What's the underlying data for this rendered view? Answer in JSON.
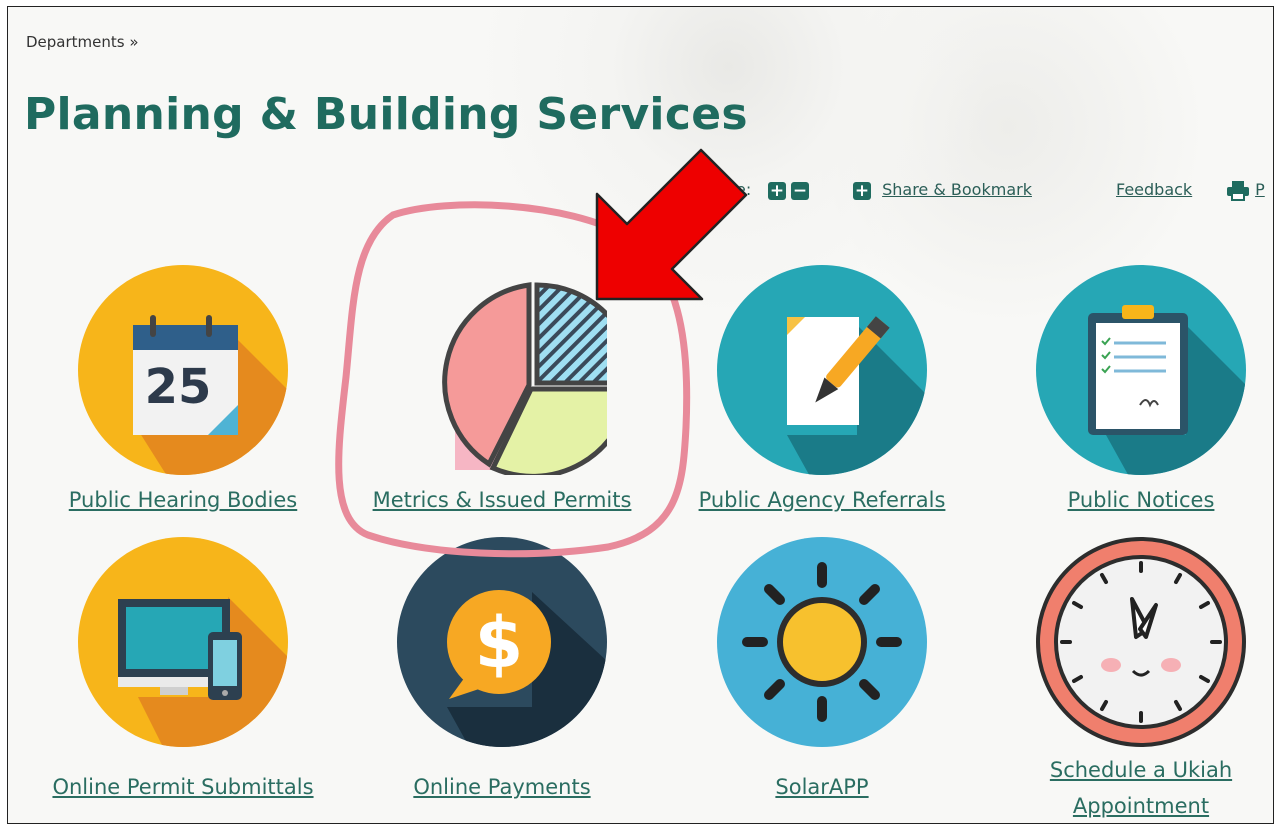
{
  "breadcrumb": "Departments »",
  "page_title": "Planning & Building Services",
  "toolbar": {
    "text_size_fragment": "e:",
    "plus_glyph": "+",
    "minus_glyph": "−",
    "share_label": "Share & Bookmark",
    "feedback_label": "Feedback",
    "print_fragment": "P"
  },
  "tiles": [
    {
      "label": "Public Hearing Bodies",
      "icon": "calendar-icon",
      "calendar_number": "25"
    },
    {
      "label": "Metrics & Issued Permits",
      "icon": "pie-chart-icon"
    },
    {
      "label": "Public Agency Referrals",
      "icon": "document-pen-icon"
    },
    {
      "label": "Public Notices",
      "icon": "clipboard-icon"
    },
    {
      "label": "Online Permit Submittals",
      "icon": "computer-phone-icon"
    },
    {
      "label": "Online Payments",
      "icon": "dollar-bubble-icon",
      "symbol": "$"
    },
    {
      "label": "SolarAPP",
      "icon": "sun-icon"
    },
    {
      "label_line1": "Schedule a Ukiah",
      "label_line2": "Appointment",
      "icon": "clock-icon"
    }
  ],
  "annotations": {
    "arrow_color": "#ee0000",
    "circle_color": "#e88a9a"
  }
}
